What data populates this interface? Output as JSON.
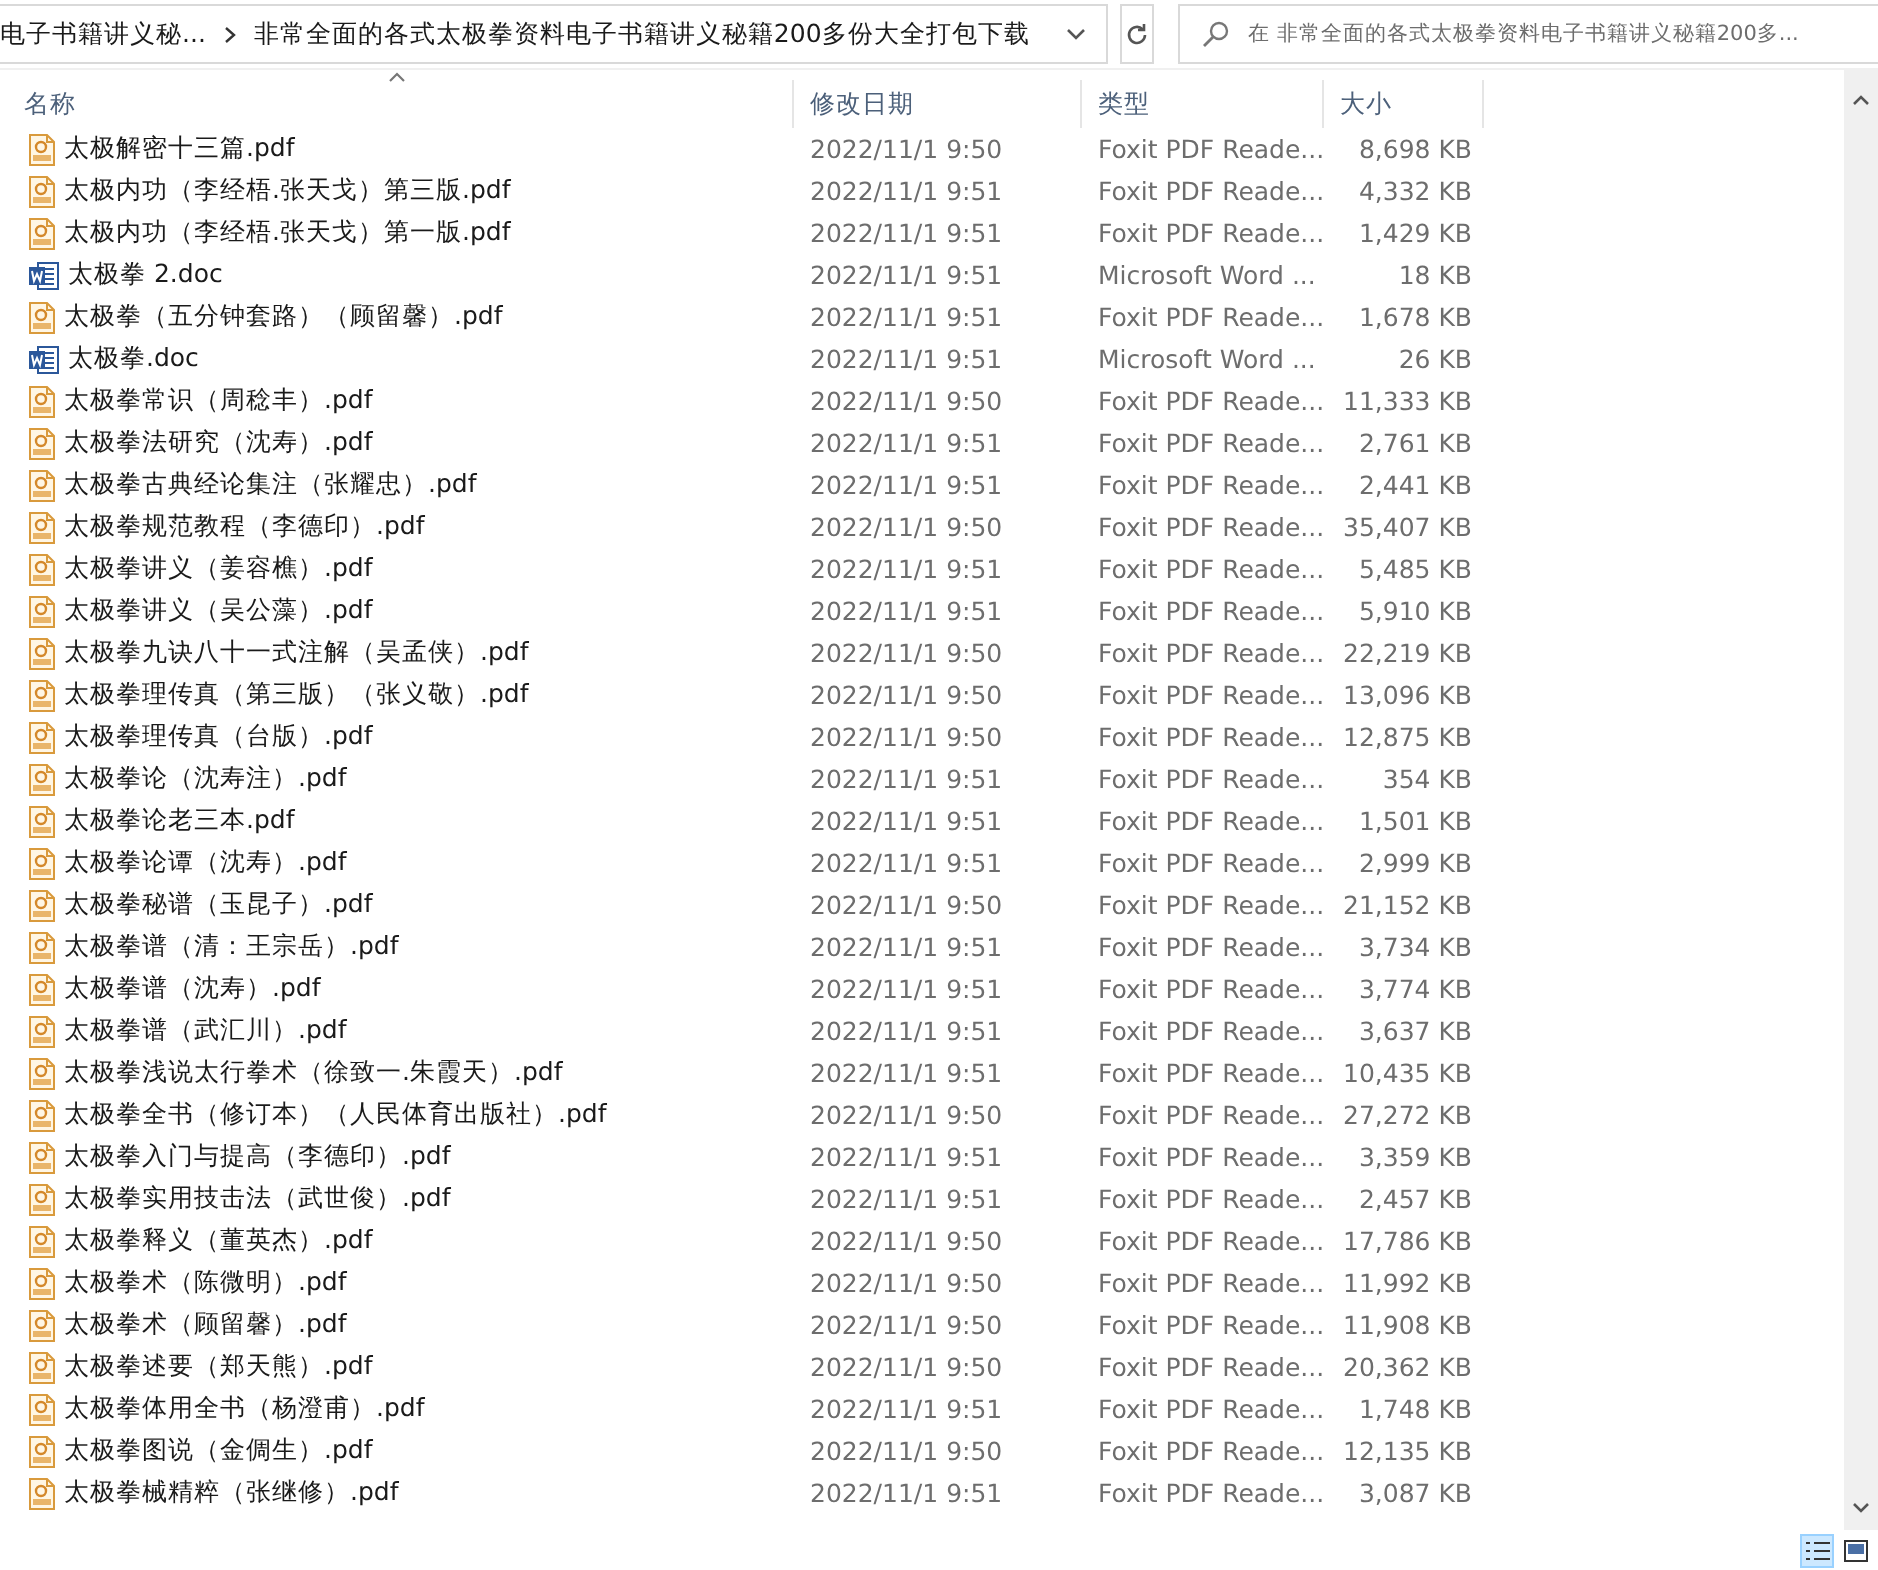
{
  "address_bar": {
    "breadcrumbs": [
      "电子书籍讲义秘...",
      "非常全面的各式太极拳资料电子书籍讲义秘籍200多份大全打包下载"
    ]
  },
  "search": {
    "placeholder": "在 非常全面的各式太极拳资料电子书籍讲义秘籍200多..."
  },
  "columns": [
    {
      "label": "名称",
      "sorted": true
    },
    {
      "label": "修改日期",
      "sorted": false
    },
    {
      "label": "类型",
      "sorted": false
    },
    {
      "label": "大小",
      "sorted": false
    }
  ],
  "files": [
    {
      "kind": "pdf",
      "name": "太极解密十三篇.pdf",
      "modified": "2022/11/1 9:50",
      "type": "Foxit PDF Reade...",
      "size": "8,698 KB"
    },
    {
      "kind": "pdf",
      "name": "太极内功（李经梧.张天戈）第三版.pdf",
      "modified": "2022/11/1 9:51",
      "type": "Foxit PDF Reade...",
      "size": "4,332 KB"
    },
    {
      "kind": "pdf",
      "name": "太极内功（李经梧.张天戈）第一版.pdf",
      "modified": "2022/11/1 9:51",
      "type": "Foxit PDF Reade...",
      "size": "1,429 KB"
    },
    {
      "kind": "doc",
      "name": "太极拳 2.doc",
      "modified": "2022/11/1 9:51",
      "type": "Microsoft Word ...",
      "size": "18 KB"
    },
    {
      "kind": "pdf",
      "name": "太极拳（五分钟套路）（顾留馨）.pdf",
      "modified": "2022/11/1 9:51",
      "type": "Foxit PDF Reade...",
      "size": "1,678 KB"
    },
    {
      "kind": "doc",
      "name": "太极拳.doc",
      "modified": "2022/11/1 9:51",
      "type": "Microsoft Word ...",
      "size": "26 KB"
    },
    {
      "kind": "pdf",
      "name": "太极拳常识（周稔丰）.pdf",
      "modified": "2022/11/1 9:50",
      "type": "Foxit PDF Reade...",
      "size": "11,333 KB"
    },
    {
      "kind": "pdf",
      "name": "太极拳法研究（沈寿）.pdf",
      "modified": "2022/11/1 9:51",
      "type": "Foxit PDF Reade...",
      "size": "2,761 KB"
    },
    {
      "kind": "pdf",
      "name": "太极拳古典经论集注（张耀忠）.pdf",
      "modified": "2022/11/1 9:51",
      "type": "Foxit PDF Reade...",
      "size": "2,441 KB"
    },
    {
      "kind": "pdf",
      "name": "太极拳规范教程（李德印）.pdf",
      "modified": "2022/11/1 9:50",
      "type": "Foxit PDF Reade...",
      "size": "35,407 KB"
    },
    {
      "kind": "pdf",
      "name": "太极拳讲义（姜容樵）.pdf",
      "modified": "2022/11/1 9:51",
      "type": "Foxit PDF Reade...",
      "size": "5,485 KB"
    },
    {
      "kind": "pdf",
      "name": "太极拳讲义（吴公藻）.pdf",
      "modified": "2022/11/1 9:51",
      "type": "Foxit PDF Reade...",
      "size": "5,910 KB"
    },
    {
      "kind": "pdf",
      "name": "太极拳九诀八十一式注解（吴孟侠）.pdf",
      "modified": "2022/11/1 9:50",
      "type": "Foxit PDF Reade...",
      "size": "22,219 KB"
    },
    {
      "kind": "pdf",
      "name": "太极拳理传真（第三版）（张义敬）.pdf",
      "modified": "2022/11/1 9:50",
      "type": "Foxit PDF Reade...",
      "size": "13,096 KB"
    },
    {
      "kind": "pdf",
      "name": "太极拳理传真（台版）.pdf",
      "modified": "2022/11/1 9:50",
      "type": "Foxit PDF Reade...",
      "size": "12,875 KB"
    },
    {
      "kind": "pdf",
      "name": "太极拳论（沈寿注）.pdf",
      "modified": "2022/11/1 9:51",
      "type": "Foxit PDF Reade...",
      "size": "354 KB"
    },
    {
      "kind": "pdf",
      "name": "太极拳论老三本.pdf",
      "modified": "2022/11/1 9:51",
      "type": "Foxit PDF Reade...",
      "size": "1,501 KB"
    },
    {
      "kind": "pdf",
      "name": "太极拳论谭（沈寿）.pdf",
      "modified": "2022/11/1 9:51",
      "type": "Foxit PDF Reade...",
      "size": "2,999 KB"
    },
    {
      "kind": "pdf",
      "name": "太极拳秘谱（玉昆子）.pdf",
      "modified": "2022/11/1 9:50",
      "type": "Foxit PDF Reade...",
      "size": "21,152 KB"
    },
    {
      "kind": "pdf",
      "name": "太极拳谱（清：王宗岳）.pdf",
      "modified": "2022/11/1 9:51",
      "type": "Foxit PDF Reade...",
      "size": "3,734 KB"
    },
    {
      "kind": "pdf",
      "name": "太极拳谱（沈寿）.pdf",
      "modified": "2022/11/1 9:51",
      "type": "Foxit PDF Reade...",
      "size": "3,774 KB"
    },
    {
      "kind": "pdf",
      "name": "太极拳谱（武汇川）.pdf",
      "modified": "2022/11/1 9:51",
      "type": "Foxit PDF Reade...",
      "size": "3,637 KB"
    },
    {
      "kind": "pdf",
      "name": "太极拳浅说太行拳术（徐致一.朱霞天）.pdf",
      "modified": "2022/11/1 9:51",
      "type": "Foxit PDF Reade...",
      "size": "10,435 KB"
    },
    {
      "kind": "pdf",
      "name": "太极拳全书（修订本）（人民体育出版社）.pdf",
      "modified": "2022/11/1 9:50",
      "type": "Foxit PDF Reade...",
      "size": "27,272 KB"
    },
    {
      "kind": "pdf",
      "name": "太极拳入门与提高（李德印）.pdf",
      "modified": "2022/11/1 9:51",
      "type": "Foxit PDF Reade...",
      "size": "3,359 KB"
    },
    {
      "kind": "pdf",
      "name": "太极拳实用技击法（武世俊）.pdf",
      "modified": "2022/11/1 9:51",
      "type": "Foxit PDF Reade...",
      "size": "2,457 KB"
    },
    {
      "kind": "pdf",
      "name": "太极拳释义（董英杰）.pdf",
      "modified": "2022/11/1 9:50",
      "type": "Foxit PDF Reade...",
      "size": "17,786 KB"
    },
    {
      "kind": "pdf",
      "name": "太极拳术（陈微明）.pdf",
      "modified": "2022/11/1 9:50",
      "type": "Foxit PDF Reade...",
      "size": "11,992 KB"
    },
    {
      "kind": "pdf",
      "name": "太极拳术（顾留馨）.pdf",
      "modified": "2022/11/1 9:50",
      "type": "Foxit PDF Reade...",
      "size": "11,908 KB"
    },
    {
      "kind": "pdf",
      "name": "太极拳述要（郑天熊）.pdf",
      "modified": "2022/11/1 9:50",
      "type": "Foxit PDF Reade...",
      "size": "20,362 KB"
    },
    {
      "kind": "pdf",
      "name": "太极拳体用全书（杨澄甫）.pdf",
      "modified": "2022/11/1 9:51",
      "type": "Foxit PDF Reade...",
      "size": "1,748 KB"
    },
    {
      "kind": "pdf",
      "name": "太极拳图说（金倜生）.pdf",
      "modified": "2022/11/1 9:50",
      "type": "Foxit PDF Reade...",
      "size": "12,135 KB"
    },
    {
      "kind": "pdf",
      "name": "太极拳械精粹（张继修）.pdf",
      "modified": "2022/11/1 9:51",
      "type": "Foxit PDF Reade...",
      "size": "3,087 KB"
    }
  ],
  "view_buttons": [
    {
      "kind": "details",
      "selected": true
    },
    {
      "kind": "large-icons",
      "selected": false
    }
  ]
}
